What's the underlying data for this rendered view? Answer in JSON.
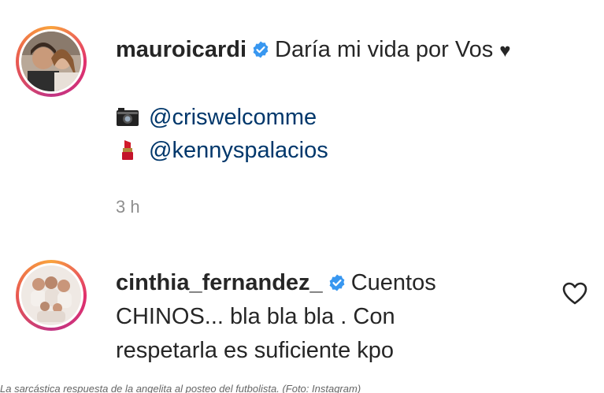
{
  "post": {
    "username": "mauroicardi",
    "caption": "Daría mi vida por Vos",
    "caption_emoji": "♥",
    "credits": [
      {
        "icon": "camera-icon",
        "handle": "@criswelcomme"
      },
      {
        "icon": "lipstick-icon",
        "handle": "@kennyspalacios"
      }
    ],
    "time": "3 h"
  },
  "comment": {
    "username": "cinthia_fernandez_",
    "text_line1": "Cuentos",
    "text_line2": "CHINOS... bla bla bla . Con",
    "text_line3": "respetarla es suficiente kpo"
  },
  "footer_caption": "La sarcástica respuesta de la angelita al posteo del futbolista. (Foto: Instagram)",
  "colors": {
    "verified": "#3897f0",
    "text": "#262626",
    "muted": "#8e8e8e",
    "mention": "#00376b"
  }
}
